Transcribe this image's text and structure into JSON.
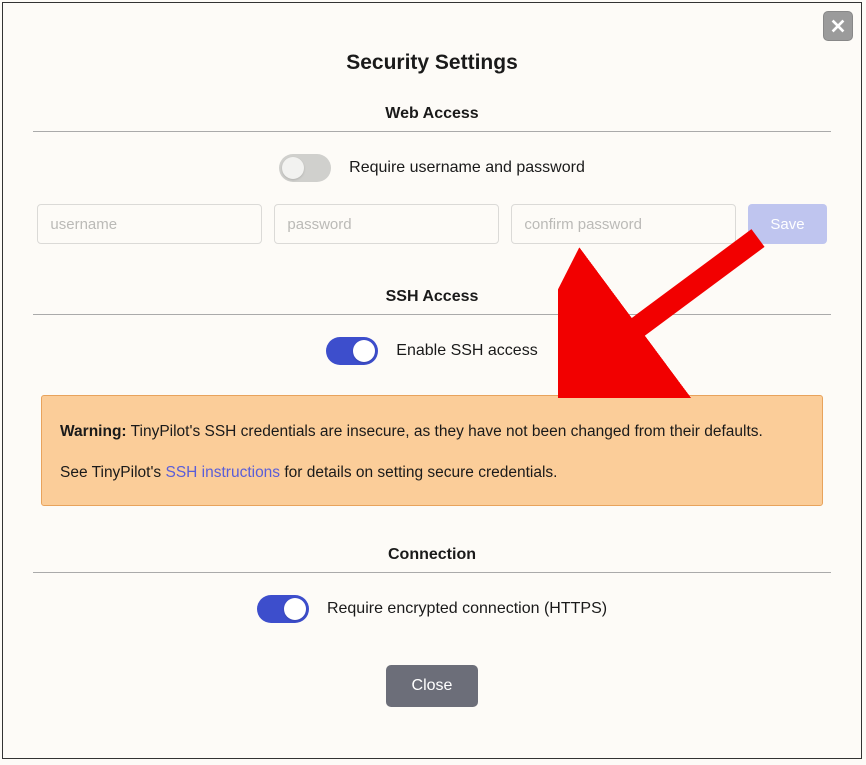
{
  "title": "Security Settings",
  "webAccess": {
    "heading": "Web Access",
    "toggleLabel": "Require username and password",
    "enabled": false,
    "usernamePlaceholder": "username",
    "passwordPlaceholder": "password",
    "confirmPlaceholder": "confirm password",
    "saveLabel": "Save"
  },
  "sshAccess": {
    "heading": "SSH Access",
    "toggleLabel": "Enable SSH access",
    "enabled": true,
    "warning": {
      "label": "Warning:",
      "text1": " TinyPilot's SSH credentials are insecure, as they have not been changed from their defaults.",
      "text2a": "See TinyPilot's ",
      "linkText": "SSH instructions",
      "text2b": " for details on setting secure credentials."
    }
  },
  "connection": {
    "heading": "Connection",
    "toggleLabel": "Require encrypted connection (HTTPS)",
    "enabled": true
  },
  "closeLabel": "Close"
}
